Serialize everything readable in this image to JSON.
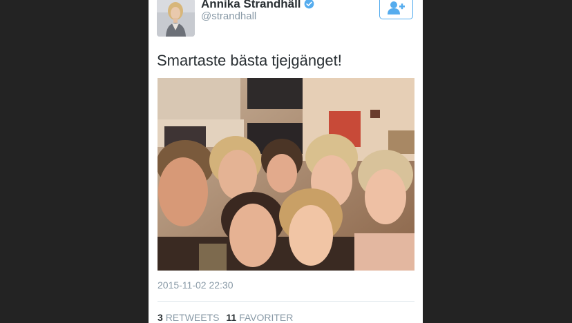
{
  "user": {
    "display_name": "Annika Strandhäll",
    "handle": "@strandhall",
    "verified": true,
    "avatar_icon": "profile-photo"
  },
  "follow_icon": "add-user-icon",
  "tweet": {
    "text": "Smartaste bästa tjejgänget!",
    "timestamp": "2015-11-02 22:30",
    "photo_icon": "group-selfie-photo"
  },
  "stats": {
    "retweets_count": "3",
    "retweets_label": "RETWEETS",
    "favorites_count": "11",
    "favorites_label": "FAVORITER"
  },
  "colors": {
    "background": "#232323",
    "accent": "#55acee",
    "text": "#292f33",
    "muted": "#8899a6"
  }
}
